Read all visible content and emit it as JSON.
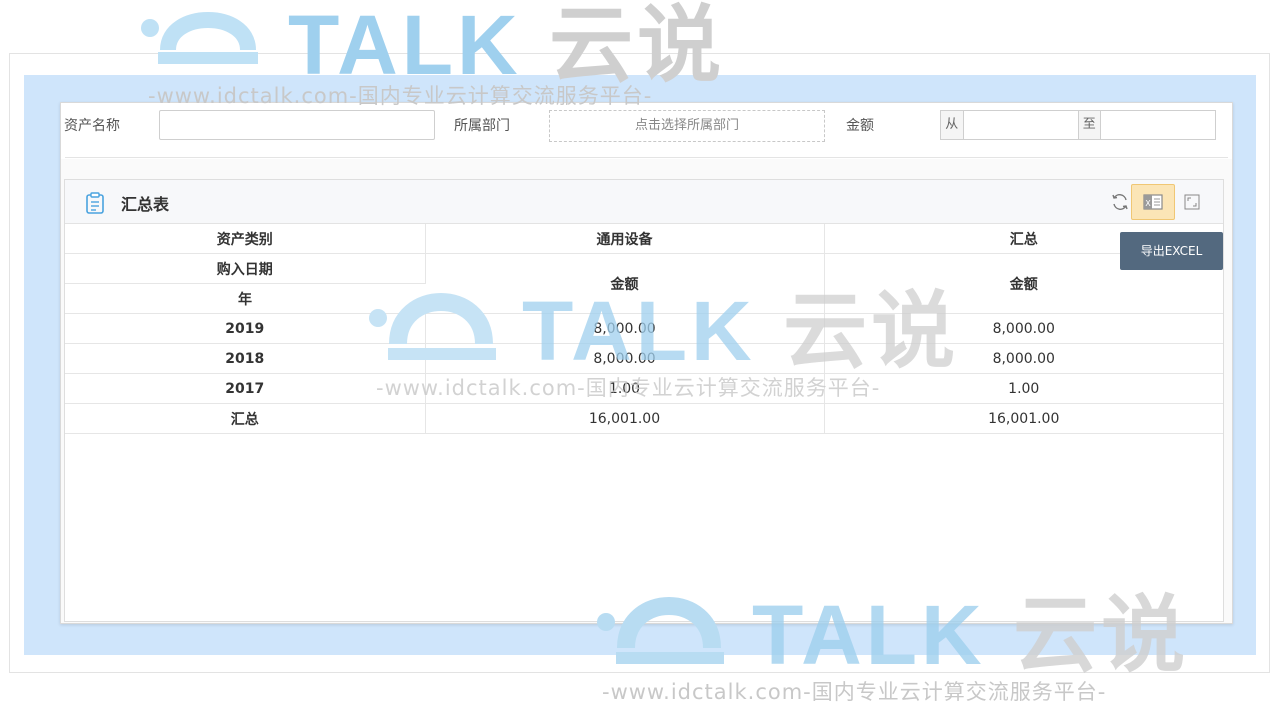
{
  "filters": {
    "asset_name_label": "资产名称",
    "asset_name_value": "",
    "department_label": "所属部门",
    "department_placeholder": "点击选择所属部门",
    "amount_label": "金额",
    "amount_from_label": "从",
    "amount_to_label": "至",
    "amount_from_value": "",
    "amount_to_value": ""
  },
  "card": {
    "title": "汇总表",
    "refresh_icon": "refresh-icon",
    "excel_icon": "excel-icon",
    "fullscreen_icon": "fullscreen-icon",
    "export_tooltip": "导出EXCEL"
  },
  "table": {
    "header_row1": [
      "资产类别",
      "通用设备",
      "汇总"
    ],
    "header_row2_left": "购入日期",
    "header_row3_left": "年",
    "amount_header": "金额",
    "rows": [
      {
        "year": "2019",
        "general": "8,000.00",
        "total": "8,000.00"
      },
      {
        "year": "2018",
        "general": "8,000.00",
        "total": "8,000.00"
      },
      {
        "year": "2017",
        "general": "1.00",
        "total": "1.00"
      },
      {
        "year": "汇总",
        "general": "16,001.00",
        "total": "16,001.00"
      }
    ]
  },
  "watermark": {
    "brand_latin": "TALK",
    "brand_cn": "云说",
    "url_text": "-www.idctalk.com-国内专业云计算交流服务平台-"
  }
}
